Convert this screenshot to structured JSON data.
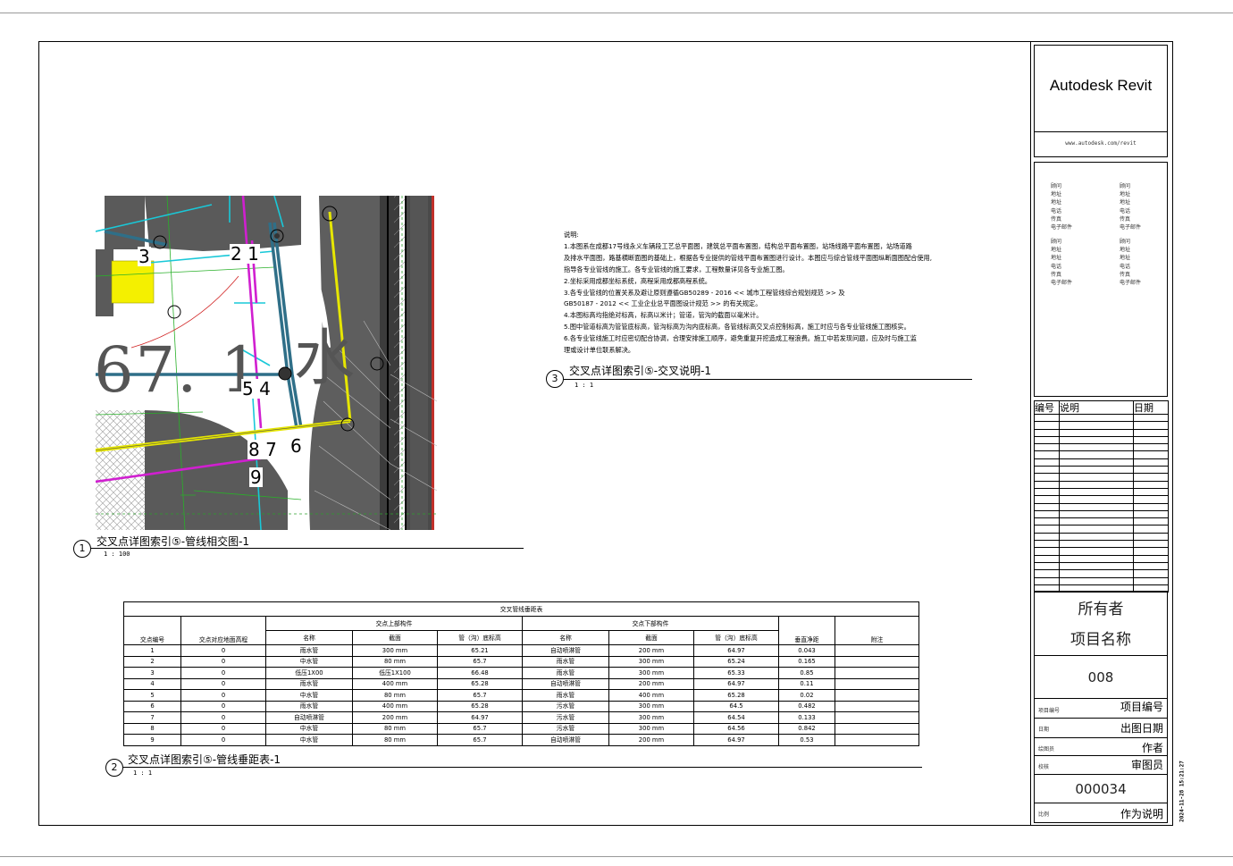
{
  "titleblock": {
    "logo": "Autodesk Revit",
    "url": "www.autodesk.com/revit",
    "contact_fields": [
      "顾问",
      "地址",
      "地址",
      "电话",
      "传真",
      "电子邮件"
    ],
    "revision_headers": [
      "编号",
      "说明",
      "日期"
    ],
    "owner": "所有者",
    "project_name": "项目名称",
    "sheet_id": "008",
    "rows": [
      {
        "label": "项目编号",
        "value": "项目编号"
      },
      {
        "label": "日期",
        "value": "出图日期"
      },
      {
        "label": "绘图员",
        "value": "作者"
      },
      {
        "label": "校核",
        "value": "审图员"
      }
    ],
    "sheet_number": "000034",
    "scale_label": "比例",
    "scale_value": "作为说明",
    "timestamp": "2024-11-28 15:21:27"
  },
  "views": {
    "v1": {
      "num": "1",
      "title": "交叉点详图索引⑤-管线相交图-1",
      "scale": "1 : 100"
    },
    "v2": {
      "num": "2",
      "title": "交叉点详图索引⑤-管线垂距表-1",
      "scale": "1 : 1"
    },
    "v3": {
      "num": "3",
      "title": "交叉点详图索引⑤-交叉说明-1",
      "scale": "1 : 1"
    }
  },
  "plan": {
    "big_label": "67. 1",
    "water_label": "水",
    "point_labels": [
      "3",
      "2 1",
      "5 4",
      "8 7",
      "6",
      "9"
    ]
  },
  "notes": {
    "heading": "说明:",
    "lines": [
      "1.本图系在成都17号线永义车辆段工艺总平面图，建筑总平面布置图，结构总平面布置图，站场线路平面布置图，站场道路",
      "及排水平面图，路基横断面图的基础上，根据各专业提供的管线平面布置图进行设计。本图应与综合管线平面图纵断面图配合使用,",
      "指导各专业管线的施工。各专业管线的施工要求，工程数量详见各专业施工图。",
      "2.坐标采用成都坐标系统，高程采用成都高程系统。",
      "3.各专业管线的位置关系及避让原则遵循GB50289 - 2016 << 城市工程管线综合规划规范 >> 及",
      "GB50187 - 2012 << 工业企业总平面图设计规范 >> 的有关规定。",
      "4.本图标高均指绝对标高，标高以米计；管道，管沟的截面以毫米计。",
      "5.图中管道标高为管管底标高，管沟标高为沟内底标高，各管线标高交叉点控制标高，施工时应与各专业管线施工图核实。",
      "6.各专业管线施工时应密切配合协调，合理安排施工顺序，避免重复开挖造成工程浪费。施工中若发现问题，应及时与施工监",
      "理或设计单位联系解决。"
    ]
  },
  "schedule": {
    "title": "交叉管线垂距表",
    "upper_group": "交点上部构件",
    "lower_group": "交点下部构件",
    "col_point": "交点编号",
    "col_ground": "交点对应地面高程",
    "col_name": "名称",
    "col_section": "截面",
    "col_elev": "管（沟）底标高",
    "col_clear": "垂直净距",
    "col_note": "附注",
    "rows": [
      [
        "1",
        "0",
        "雨水管",
        "300 mm",
        "65.21",
        "自动喷淋管",
        "200 mm",
        "64.97",
        "0.043",
        ""
      ],
      [
        "2",
        "0",
        "中水管",
        "80 mm",
        "65.7",
        "雨水管",
        "300 mm",
        "65.24",
        "0.165",
        ""
      ],
      [
        "3",
        "0",
        "低压1X00",
        "低压1X100",
        "66.48",
        "雨水管",
        "300 mm",
        "65.33",
        "0.85",
        ""
      ],
      [
        "4",
        "0",
        "雨水管",
        "400 mm",
        "65.28",
        "自动喷淋管",
        "200 mm",
        "64.97",
        "0.11",
        ""
      ],
      [
        "5",
        "0",
        "中水管",
        "80 mm",
        "65.7",
        "雨水管",
        "400 mm",
        "65.28",
        "0.02",
        ""
      ],
      [
        "6",
        "0",
        "雨水管",
        "400 mm",
        "65.28",
        "污水管",
        "300 mm",
        "64.5",
        "0.482",
        ""
      ],
      [
        "7",
        "0",
        "自动喷淋管",
        "200 mm",
        "64.97",
        "污水管",
        "300 mm",
        "64.54",
        "0.133",
        ""
      ],
      [
        "8",
        "0",
        "中水管",
        "80 mm",
        "65.7",
        "污水管",
        "300 mm",
        "64.56",
        "0.842",
        ""
      ],
      [
        "9",
        "0",
        "中水管",
        "80 mm",
        "65.7",
        "自动喷淋管",
        "200 mm",
        "64.97",
        "0.53",
        ""
      ]
    ]
  },
  "colors": {
    "pipe_blue": "#2f6f88",
    "pipe_magenta": "#d01fd0",
    "pipe_cyan": "#19c8d8",
    "pipe_yellow": "#e6e600",
    "hatch_grey": "#5a5a5a"
  }
}
